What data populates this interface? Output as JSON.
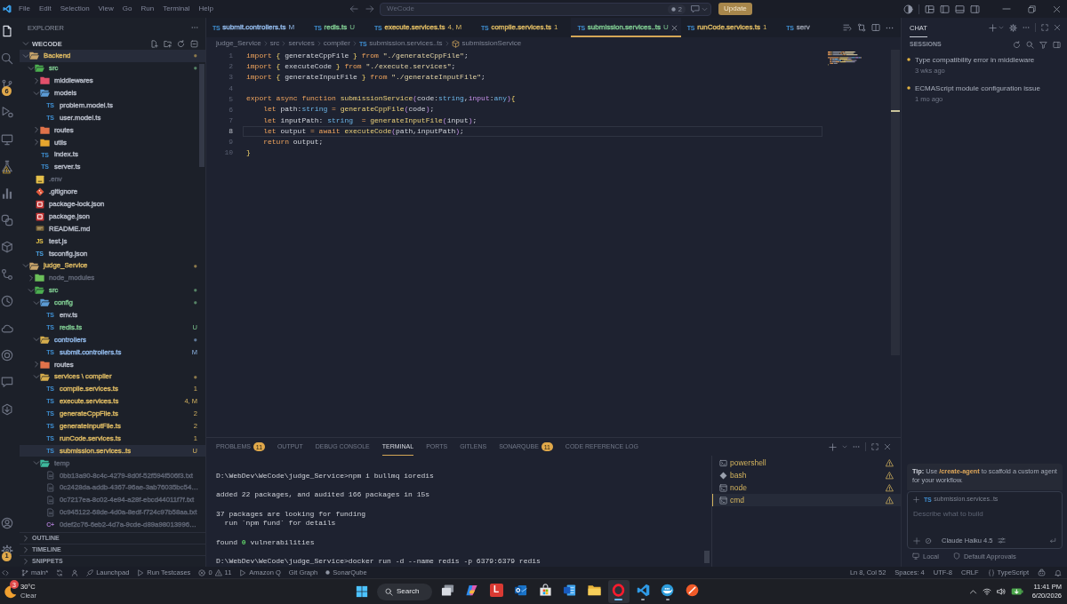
{
  "title_bar": {
    "menu": [
      "File",
      "Edit",
      "Selection",
      "View",
      "Go",
      "Run",
      "Terminal",
      "Help"
    ],
    "command_center": "WeCode",
    "agent_count": "2",
    "update_button": "Update"
  },
  "activity_bar": {
    "top": [
      {
        "selected": true
      },
      {
        "selected": false
      },
      {
        "selected": false,
        "badge": "6"
      },
      {
        "selected": false
      },
      {
        "selected": false
      },
      {
        "selected": false
      },
      {
        "selected": false
      },
      {
        "selected": false
      },
      {
        "selected": false
      },
      {
        "selected": false
      },
      {
        "selected": false
      },
      {
        "selected": false
      },
      {
        "selected": false
      },
      {
        "selected": false
      },
      {
        "selected": false
      }
    ],
    "bottom": [
      {
        "selected": false
      },
      {
        "selected": false,
        "badge": "1"
      }
    ]
  },
  "explorer": {
    "title": "EXPLORER",
    "workspace": {
      "name": "WECODE",
      "expanded": true
    },
    "tree": [
      {
        "name": "Backend",
        "kind": "project",
        "color": "#d6b461",
        "expanded": true,
        "selected": true,
        "decoration": "●",
        "children": [
          {
            "name": "src",
            "kind": "src",
            "color": "#7cc58e",
            "expanded": true,
            "selected": false,
            "decoration": "●",
            "children": [
              {
                "name": "middlewares",
                "kind": "middleware",
                "expanded": false,
                "selected": false
              },
              {
                "name": "models",
                "kind": "models",
                "expanded": true,
                "selected": false,
                "children": [
                  {
                    "name": "problem.model.ts",
                    "kind": "ts",
                    "icon_label": "TS",
                    "selected": false
                  },
                  {
                    "name": "user.model.ts",
                    "kind": "ts",
                    "icon_label": "TS",
                    "selected": false
                  }
                ]
              },
              {
                "name": "routes",
                "kind": "routes",
                "expanded": false,
                "selected": false
              },
              {
                "name": "utils",
                "kind": "utils",
                "expanded": false,
                "selected": false
              },
              {
                "name": "index.ts",
                "kind": "ts",
                "icon_label": "TS",
                "selected": false
              },
              {
                "name": "server.ts",
                "kind": "ts",
                "icon_label": "TS",
                "selected": false
              }
            ]
          },
          {
            "name": ".env",
            "kind": "env",
            "color": "#5d6372",
            "selected": false
          },
          {
            "name": ".gitignore",
            "kind": "git",
            "selected": false
          },
          {
            "name": "package-lock.json",
            "kind": "npm",
            "selected": false
          },
          {
            "name": "package.json",
            "kind": "npm",
            "selected": false
          },
          {
            "name": "README.md",
            "kind": "md",
            "selected": false
          },
          {
            "name": "test.js",
            "kind": "js",
            "icon_label": "JS",
            "selected": false
          },
          {
            "name": "tsconfig.json",
            "kind": "tsconfig",
            "icon_label": "TS",
            "selected": false
          }
        ]
      },
      {
        "name": "judge_Service",
        "kind": "project",
        "color": "#d6b461",
        "expanded": true,
        "selected": false,
        "decoration": "●",
        "children": [
          {
            "name": "node_modules",
            "kind": "modules",
            "color": "#5d6372",
            "expanded": false,
            "selected": false
          },
          {
            "name": "src",
            "kind": "src",
            "color": "#7cc58e",
            "expanded": true,
            "selected": false,
            "decoration": "●",
            "children": [
              {
                "name": "config",
                "kind": "config",
                "color": "#7cc58e",
                "expanded": true,
                "selected": false,
                "decoration": "●",
                "children": [
                  {
                    "name": "env.ts",
                    "kind": "ts",
                    "icon_label": "TS",
                    "selected": false
                  },
                  {
                    "name": "redis.ts",
                    "kind": "ts",
                    "icon_label": "TS",
                    "color": "#7cc58e",
                    "selected": false,
                    "decoration": "U"
                  }
                ]
              },
              {
                "name": "controllers",
                "kind": "controllers",
                "color": "#8db3e2",
                "expanded": true,
                "selected": false,
                "decoration": "●",
                "children": [
                  {
                    "name": "submit.controllers.ts",
                    "kind": "ts",
                    "icon_label": "TS",
                    "color": "#8db3e2",
                    "selected": false,
                    "decoration": "M"
                  }
                ]
              },
              {
                "name": "routes",
                "kind": "routes",
                "expanded": false,
                "selected": false
              },
              {
                "name": "services \\ compiler",
                "kind": "services",
                "color": "#d6b461",
                "expanded": true,
                "selected": false,
                "decoration": "●",
                "children": [
                  {
                    "name": "compile.services.ts",
                    "kind": "ts",
                    "icon_label": "TS",
                    "color": "#d6b461",
                    "selected": false,
                    "decoration": "1"
                  },
                  {
                    "name": "execute.services.ts",
                    "kind": "ts",
                    "icon_label": "TS",
                    "color": "#d6b461",
                    "selected": false,
                    "decoration": "4, M"
                  },
                  {
                    "name": "generateCppFile.ts",
                    "kind": "ts",
                    "icon_label": "TS",
                    "color": "#d6b461",
                    "selected": false,
                    "decoration": "2"
                  },
                  {
                    "name": "generateInputFile.ts",
                    "kind": "ts",
                    "icon_label": "TS",
                    "color": "#d6b461",
                    "selected": false,
                    "decoration": "2"
                  },
                  {
                    "name": "runCode.services.ts",
                    "kind": "ts",
                    "icon_label": "TS",
                    "color": "#d6b461",
                    "selected": false,
                    "decoration": "1"
                  },
                  {
                    "name": "submission.services..ts",
                    "kind": "ts",
                    "icon_label": "TS",
                    "color": "#d6b461",
                    "selected": true,
                    "decoration": "U"
                  }
                ]
              },
              {
                "name": "temp",
                "kind": "temp",
                "color": "#5d6372",
                "expanded": true,
                "selected": false,
                "children": [
                  {
                    "name": "0bb13a90-8c4c-4279-8d0f-52f594f506f3.txt",
                    "kind": "txt",
                    "color": "#5d6372",
                    "selected": false
                  },
                  {
                    "name": "0c2428da-addb-4367-96ae-3ab76035bc54…",
                    "kind": "txt",
                    "color": "#5d6372",
                    "selected": false
                  },
                  {
                    "name": "0c7217ea-8c02-4e94-a28f-ebcd44011f7f.txt",
                    "kind": "txt",
                    "color": "#5d6372",
                    "selected": false
                  },
                  {
                    "name": "0c945122-68de-4d0a-8edf-f724c97b58aa.txt",
                    "kind": "txt",
                    "color": "#5d6372",
                    "selected": false
                  },
                  {
                    "name": "0def2c76-6eb2-4d7a-9cde-d89a98013996…",
                    "kind": "cpp",
                    "icon_label": "C+",
                    "color": "#5d6372",
                    "selected": false
                  }
                ]
              }
            ]
          }
        ]
      }
    ],
    "sections": [
      {
        "label": "OUTLINE",
        "expanded": false
      },
      {
        "label": "TIMELINE",
        "expanded": false
      },
      {
        "label": "SNIPPETS",
        "expanded": false
      }
    ]
  },
  "editor": {
    "tabs": [
      {
        "icon_label": "TS",
        "name": "submit.controllers.ts",
        "decoration": "M",
        "color": "#8db3e2",
        "selected": false
      },
      {
        "icon_label": "TS",
        "name": "redis.ts",
        "decoration": "U",
        "color": "#7cc58e",
        "selected": false
      },
      {
        "icon_label": "TS",
        "name": "execute.services.ts",
        "decoration": "4, M",
        "color": "#d6b461",
        "selected": false
      },
      {
        "icon_label": "TS",
        "name": "compile.services.ts",
        "decoration": "1",
        "color": "#d6b461",
        "selected": false
      },
      {
        "icon_label": "TS",
        "name": "submission.services..ts",
        "decoration": "U",
        "color": "#7cc58e",
        "selected": true
      },
      {
        "icon_label": "TS",
        "name": "runCode.services.ts",
        "decoration": "1",
        "color": "#d6b461",
        "selected": false
      },
      {
        "icon_label": "TS",
        "name": "serv",
        "selected": false
      }
    ],
    "breadcrumbs": [
      {
        "label": "judge_Service",
        "kind": "folder"
      },
      {
        "label": "src",
        "kind": "folder"
      },
      {
        "label": "services",
        "kind": "folder"
      },
      {
        "label": "compiler",
        "kind": "folder"
      },
      {
        "label": "submission.services..ts",
        "kind": "file",
        "icon_label": "TS"
      },
      {
        "label": "submissionService",
        "kind": "symbol"
      }
    ],
    "lines": [
      {
        "number": "1",
        "current": false,
        "tokens": [
          {
            "kind": "keyword",
            "text": "import"
          },
          {
            "kind": "brace",
            "text": " {"
          },
          {
            "kind": "plain",
            "text": " generateCppFile "
          },
          {
            "kind": "brace",
            "text": "}"
          },
          {
            "kind": "keyword",
            "text": " from"
          },
          {
            "kind": "string",
            "text": " \"./generateCppFile\""
          },
          {
            "kind": "plain",
            "text": ";"
          }
        ]
      },
      {
        "number": "2",
        "current": false,
        "tokens": [
          {
            "kind": "keyword",
            "text": "import"
          },
          {
            "kind": "brace",
            "text": " {"
          },
          {
            "kind": "plain",
            "text": " executeCode "
          },
          {
            "kind": "brace",
            "text": "}"
          },
          {
            "kind": "keyword",
            "text": " from"
          },
          {
            "kind": "string",
            "text": " \"./execute.services\""
          },
          {
            "kind": "plain",
            "text": ";"
          }
        ]
      },
      {
        "number": "3",
        "current": false,
        "tokens": [
          {
            "kind": "keyword",
            "text": "import"
          },
          {
            "kind": "brace",
            "text": " {"
          },
          {
            "kind": "plain",
            "text": " generateInputFile "
          },
          {
            "kind": "brace",
            "text": "}"
          },
          {
            "kind": "keyword",
            "text": " from"
          },
          {
            "kind": "string",
            "text": " \"./generateInputFile\""
          },
          {
            "kind": "plain",
            "text": ";"
          }
        ]
      },
      {
        "number": "4",
        "current": false
      },
      {
        "number": "5",
        "current": false,
        "tokens": [
          {
            "kind": "keyword",
            "text": "export async function"
          },
          {
            "kind": "func",
            "text": " submissionService"
          },
          {
            "kind": "paren",
            "text": "("
          },
          {
            "kind": "plain",
            "text": "code:"
          },
          {
            "kind": "type",
            "text": "string"
          },
          {
            "kind": "plain",
            "text": ","
          },
          {
            "kind": "param",
            "text": "input"
          },
          {
            "kind": "plain",
            "text": ":"
          },
          {
            "kind": "type",
            "text": "any"
          },
          {
            "kind": "paren",
            "text": ")"
          },
          {
            "kind": "brace",
            "text": "{"
          }
        ]
      },
      {
        "number": "6",
        "current": false,
        "tokens": [
          {
            "kind": "keyword",
            "text": "    let"
          },
          {
            "kind": "plain",
            "text": " path:"
          },
          {
            "kind": "type",
            "text": "string"
          },
          {
            "kind": "keyword",
            "text": " ="
          },
          {
            "kind": "func",
            "text": " generateCppFile"
          },
          {
            "kind": "paren",
            "text": "("
          },
          {
            "kind": "plain",
            "text": "code"
          },
          {
            "kind": "paren",
            "text": ")"
          },
          {
            "kind": "plain",
            "text": ";"
          }
        ]
      },
      {
        "number": "7",
        "current": false,
        "tokens": [
          {
            "kind": "keyword",
            "text": "    let"
          },
          {
            "kind": "plain",
            "text": " inputPath: "
          },
          {
            "kind": "type",
            "text": "string"
          },
          {
            "kind": "keyword",
            "text": "  ="
          },
          {
            "kind": "func",
            "text": " generateInputFile"
          },
          {
            "kind": "paren",
            "text": "("
          },
          {
            "kind": "plain",
            "text": "input"
          },
          {
            "kind": "paren",
            "text": ")"
          },
          {
            "kind": "plain",
            "text": ";"
          }
        ]
      },
      {
        "number": "8",
        "current": true,
        "tokens": [
          {
            "kind": "keyword",
            "text": "    let"
          },
          {
            "kind": "plain",
            "text": " output "
          },
          {
            "kind": "keyword",
            "text": "= await"
          },
          {
            "kind": "func",
            "text": " executeCode"
          },
          {
            "kind": "paren",
            "text": "("
          },
          {
            "kind": "plain",
            "text": "path,inputPath"
          },
          {
            "kind": "paren",
            "text": ")"
          },
          {
            "kind": "plain",
            "text": ";"
          }
        ]
      },
      {
        "number": "9",
        "current": false,
        "tokens": [
          {
            "kind": "keyword",
            "text": "    return"
          },
          {
            "kind": "plain",
            "text": " output;"
          }
        ]
      },
      {
        "number": "10",
        "current": false,
        "tokens": [
          {
            "kind": "brace",
            "text": "}"
          }
        ]
      }
    ]
  },
  "panel": {
    "tabs": [
      {
        "label": "PROBLEMS",
        "badge": "11",
        "selected": false
      },
      {
        "label": "OUTPUT",
        "selected": false
      },
      {
        "label": "DEBUG CONSOLE",
        "selected": false
      },
      {
        "label": "TERMINAL",
        "selected": true
      },
      {
        "label": "PORTS",
        "selected": false
      },
      {
        "label": "GITLENS",
        "selected": false
      },
      {
        "label": "SONARQUBE",
        "badge": "11",
        "selected": false
      },
      {
        "label": "CODE REFERENCE LOG",
        "selected": false
      }
    ],
    "terminal": [
      [
        "D:\\WebDev\\WeCode\\judge_Service>npm i bullmq ioredis"
      ],
      [
        "added 22 packages, and audited 166 packages in 15s"
      ],
      [
        "37 packages are looking for funding",
        "  run `npm fund` for details"
      ],
      [
        "found **0** vulnerabilities"
      ],
      [
        "D:\\WebDev\\WeCode\\judge_Service>docker run -d --name redis -p 6379:6379 redis"
      ]
    ],
    "terminals": [
      {
        "name": "powershell",
        "selected": false
      },
      {
        "name": "bash",
        "selected": false
      },
      {
        "name": "node",
        "selected": false
      },
      {
        "name": "cmd",
        "selected": true
      }
    ]
  },
  "chat": {
    "title": "CHAT",
    "sessions_title": "SESSIONS",
    "sessions": [
      {
        "title": "Type compatibility error in middleware",
        "time": "3 wks ago"
      },
      {
        "title": "ECMAScript module configuration issue",
        "time": "1 mo ago"
      }
    ],
    "tip": "**Tip:** Use **/create-agent** to scaffold a custom agent for your workflow.",
    "context_file": {
      "icon_label": "TS",
      "name": "submission.services..ts"
    },
    "input": {
      "placeholder": "Describe what to build"
    },
    "model": "Claude Haiku 4.5",
    "footer": [
      "Local",
      "Default Approvals"
    ]
  },
  "status_bar": {
    "branch": "main*",
    "left": [
      "Launchpad",
      "Run Testcases"
    ],
    "errors": "0",
    "warnings": "11",
    "extensions": [
      "Amazon Q",
      "Git Graph",
      "SonarQube"
    ],
    "right": [
      "Ln 8, Col 52",
      "Spaces: 4",
      "UTF-8",
      "CRLF",
      "TypeScript"
    ]
  },
  "taskbar": {
    "weather": {
      "badge": "3",
      "temperature": "30°C",
      "condition": "Clear"
    },
    "search": "Search",
    "apps": [
      {
        "running": false,
        "selected": false
      },
      {
        "running": false,
        "selected": false
      },
      {
        "label": "L",
        "running": false,
        "selected": false
      },
      {
        "running": false,
        "selected": false
      },
      {
        "running": false,
        "selected": false
      },
      {
        "running": false,
        "selected": false
      },
      {
        "running": false,
        "selected": false
      },
      {
        "running": true,
        "selected": true
      },
      {
        "running": true,
        "selected": false
      },
      {
        "running": true,
        "selected": false
      },
      {
        "running": false,
        "selected": false
      }
    ],
    "clock": {
      "time": "11:41 PM",
      "date": "6/20/2026"
    }
  }
}
